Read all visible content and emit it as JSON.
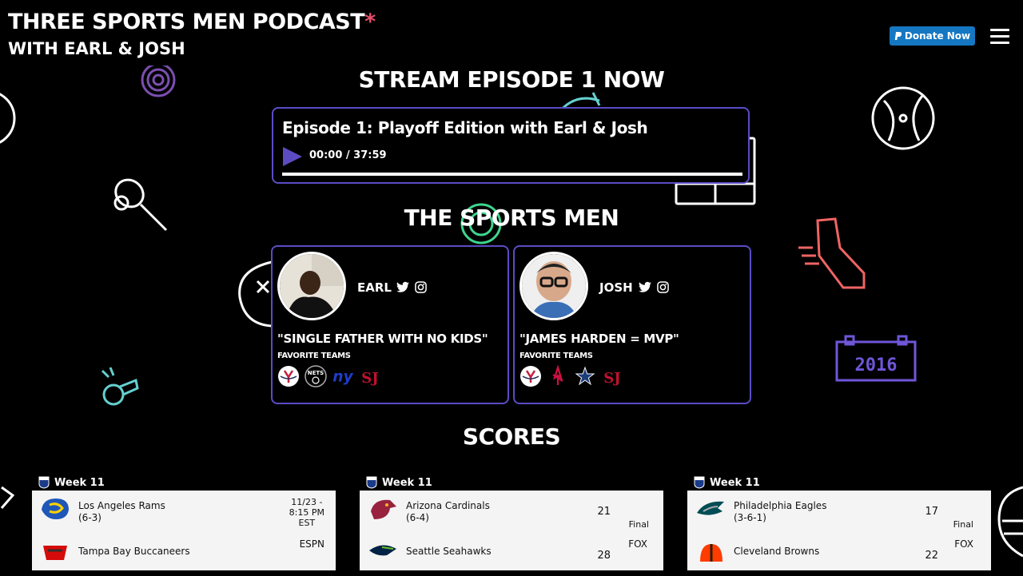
{
  "header": {
    "title_line1": "THREE SPORTS MEN PODCAST",
    "title_star": "*",
    "title_line2": "WITH EARL & JOSH",
    "donate_label": "Donate Now"
  },
  "stream": {
    "heading": "STREAM EPISODE 1 NOW",
    "episode_title": "Episode 1: Playoff Edition with Earl & Josh",
    "time": "00:00 / 37:59"
  },
  "hosts": {
    "heading": "THE SPORTS MEN",
    "items": [
      {
        "name": "EARL",
        "quote": "\"SINGLE FATHER WITH NO KIDS\"",
        "fav_label": "FAVORITE TEAMS",
        "teams": [
          "yankees-logo",
          "nets-logo",
          "giants-logo",
          "st-johns-logo"
        ]
      },
      {
        "name": "JOSH",
        "quote": "\"JAMES HARDEN = MVP\"",
        "fav_label": "FAVORITE TEAMS",
        "teams": [
          "yankees-logo",
          "rockets-logo",
          "cowboys-logo",
          "st-johns-logo"
        ]
      }
    ]
  },
  "scores": {
    "heading": "SCORES",
    "games": [
      {
        "week": "Week 11",
        "home": {
          "name": "Los Angeles Rams",
          "record": "(6-3)",
          "score": ""
        },
        "away": {
          "name": "Tampa Bay Buccaneers",
          "record": "",
          "score": ""
        },
        "status_top": "11/23 -",
        "status_mid": "8:15 PM",
        "status_bot": "EST",
        "network": "ESPN"
      },
      {
        "week": "Week 11",
        "home": {
          "name": "Arizona Cardinals",
          "record": "(6-4)",
          "score": "21"
        },
        "away": {
          "name": "Seattle Seahawks",
          "record": "",
          "score": "28"
        },
        "status_top": "",
        "status_mid": "",
        "status_bot": "Final",
        "network": "FOX"
      },
      {
        "week": "Week 11",
        "home": {
          "name": "Philadelphia Eagles",
          "record": "(3-6-1)",
          "score": "17"
        },
        "away": {
          "name": "Cleveland Browns",
          "record": "",
          "score": "22"
        },
        "status_top": "",
        "status_mid": "",
        "status_bot": "Final",
        "network": "FOX"
      }
    ]
  },
  "colors": {
    "accent_purple": "#5b4cc4",
    "title_star": "#e9506a",
    "donate_blue": "#1577c2"
  }
}
